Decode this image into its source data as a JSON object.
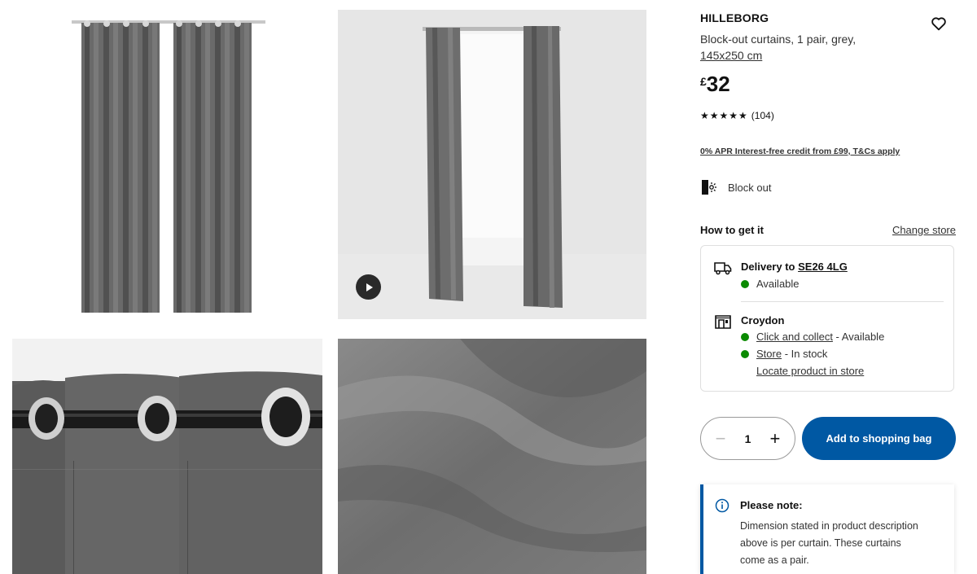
{
  "product": {
    "name": "HILLEBORG",
    "description": "Block-out curtains, 1 pair, grey,",
    "size": "145x250 cm",
    "currency": "£",
    "price": "32",
    "rating": {
      "stars": "★★★★★",
      "value": 5,
      "count": "(104)"
    },
    "credit_link": "0% APR Interest-free credit from £99, T&Cs apply",
    "feature": "Block out"
  },
  "fulfilment": {
    "heading": "How to get it",
    "change_store": "Change store",
    "delivery": {
      "label": "Delivery to",
      "postcode": "SE26 4LG",
      "status": "Available"
    },
    "store": {
      "name": "Croydon",
      "click_collect_link": "Click and collect",
      "click_collect_status": " - Available",
      "store_link": "Store",
      "store_status": " - In stock",
      "locate_link": "Locate product in store"
    }
  },
  "purchase": {
    "quantity": "1",
    "minus": "−",
    "plus": "+",
    "add_label": "Add to shopping bag"
  },
  "note": {
    "title": "Please note:",
    "body": "Dimension stated in product description above is per curtain. These curtains come as a pair."
  },
  "colors": {
    "primary_blue": "#0058a3",
    "available_green": "#0a8a00",
    "curtain_grey": "#6b6b6b"
  },
  "icons": [
    "heart-icon",
    "blockout-icon",
    "truck-icon",
    "store-icon",
    "info-icon",
    "play-icon"
  ]
}
